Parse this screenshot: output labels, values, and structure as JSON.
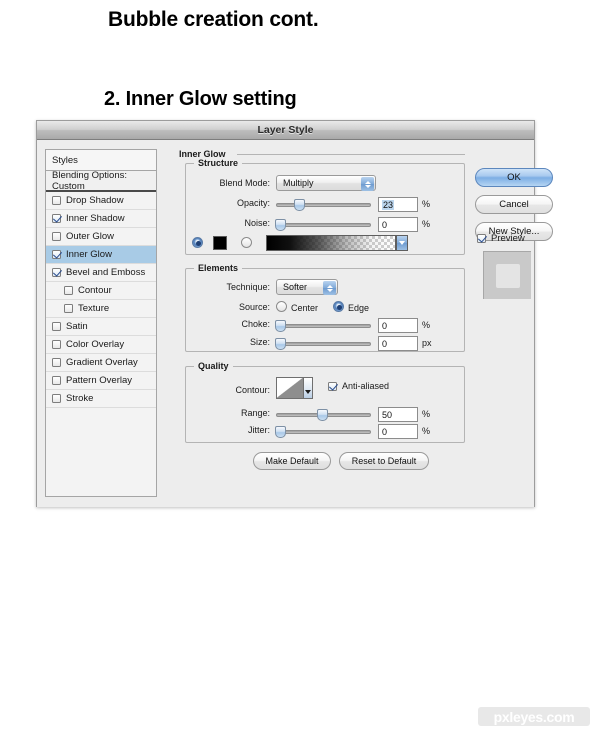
{
  "page": {
    "title": "Bubble creation cont.",
    "step": "2.  Inner Glow setting"
  },
  "dialog": {
    "title": "Layer Style"
  },
  "styles_panel": {
    "header": "Styles",
    "blending_options": "Blending Options: Custom",
    "items": [
      {
        "label": "Drop Shadow",
        "checked": false,
        "selected": false,
        "indent": false
      },
      {
        "label": "Inner Shadow",
        "checked": true,
        "selected": false,
        "indent": false
      },
      {
        "label": "Outer Glow",
        "checked": false,
        "selected": false,
        "indent": false
      },
      {
        "label": "Inner Glow",
        "checked": true,
        "selected": true,
        "indent": false
      },
      {
        "label": "Bevel and Emboss",
        "checked": true,
        "selected": false,
        "indent": false
      },
      {
        "label": "Contour",
        "checked": false,
        "selected": false,
        "indent": true
      },
      {
        "label": "Texture",
        "checked": false,
        "selected": false,
        "indent": true
      },
      {
        "label": "Satin",
        "checked": false,
        "selected": false,
        "indent": false
      },
      {
        "label": "Color Overlay",
        "checked": false,
        "selected": false,
        "indent": false
      },
      {
        "label": "Gradient Overlay",
        "checked": false,
        "selected": false,
        "indent": false
      },
      {
        "label": "Pattern Overlay",
        "checked": false,
        "selected": false,
        "indent": false
      },
      {
        "label": "Stroke",
        "checked": false,
        "selected": false,
        "indent": false
      }
    ]
  },
  "inner_glow": {
    "section_title": "Inner Glow",
    "structure": {
      "title": "Structure",
      "blend_mode_label": "Blend Mode:",
      "blend_mode_value": "Multiply",
      "opacity_label": "Opacity:",
      "opacity_value": "23",
      "opacity_unit": "%",
      "opacity_percent": 23,
      "noise_label": "Noise:",
      "noise_value": "0",
      "noise_unit": "%",
      "noise_percent": 0,
      "fill_type": "color",
      "color_swatch": "#000000",
      "gradient_from": "#000000",
      "gradient_to": "transparent"
    },
    "elements": {
      "title": "Elements",
      "technique_label": "Technique:",
      "technique_value": "Softer",
      "source_label": "Source:",
      "source_center_label": "Center",
      "source_edge_label": "Edge",
      "source_selected": "Edge",
      "choke_label": "Choke:",
      "choke_value": "0",
      "choke_unit": "%",
      "choke_percent": 0,
      "size_label": "Size:",
      "size_value": "0",
      "size_unit": "px",
      "size_percent": 0
    },
    "quality": {
      "title": "Quality",
      "contour_label": "Contour:",
      "anti_aliased_label": "Anti-aliased",
      "anti_aliased_checked": true,
      "range_label": "Range:",
      "range_value": "50",
      "range_unit": "%",
      "range_percent": 50,
      "jitter_label": "Jitter:",
      "jitter_value": "0",
      "jitter_unit": "%",
      "jitter_percent": 0
    },
    "footer": {
      "make_default": "Make Default",
      "reset_to_default": "Reset to Default"
    }
  },
  "actions": {
    "ok": "OK",
    "cancel": "Cancel",
    "new_style": "New Style...",
    "preview_label": "Preview",
    "preview_checked": true
  },
  "watermark": {
    "text": "pxleyes.com"
  }
}
